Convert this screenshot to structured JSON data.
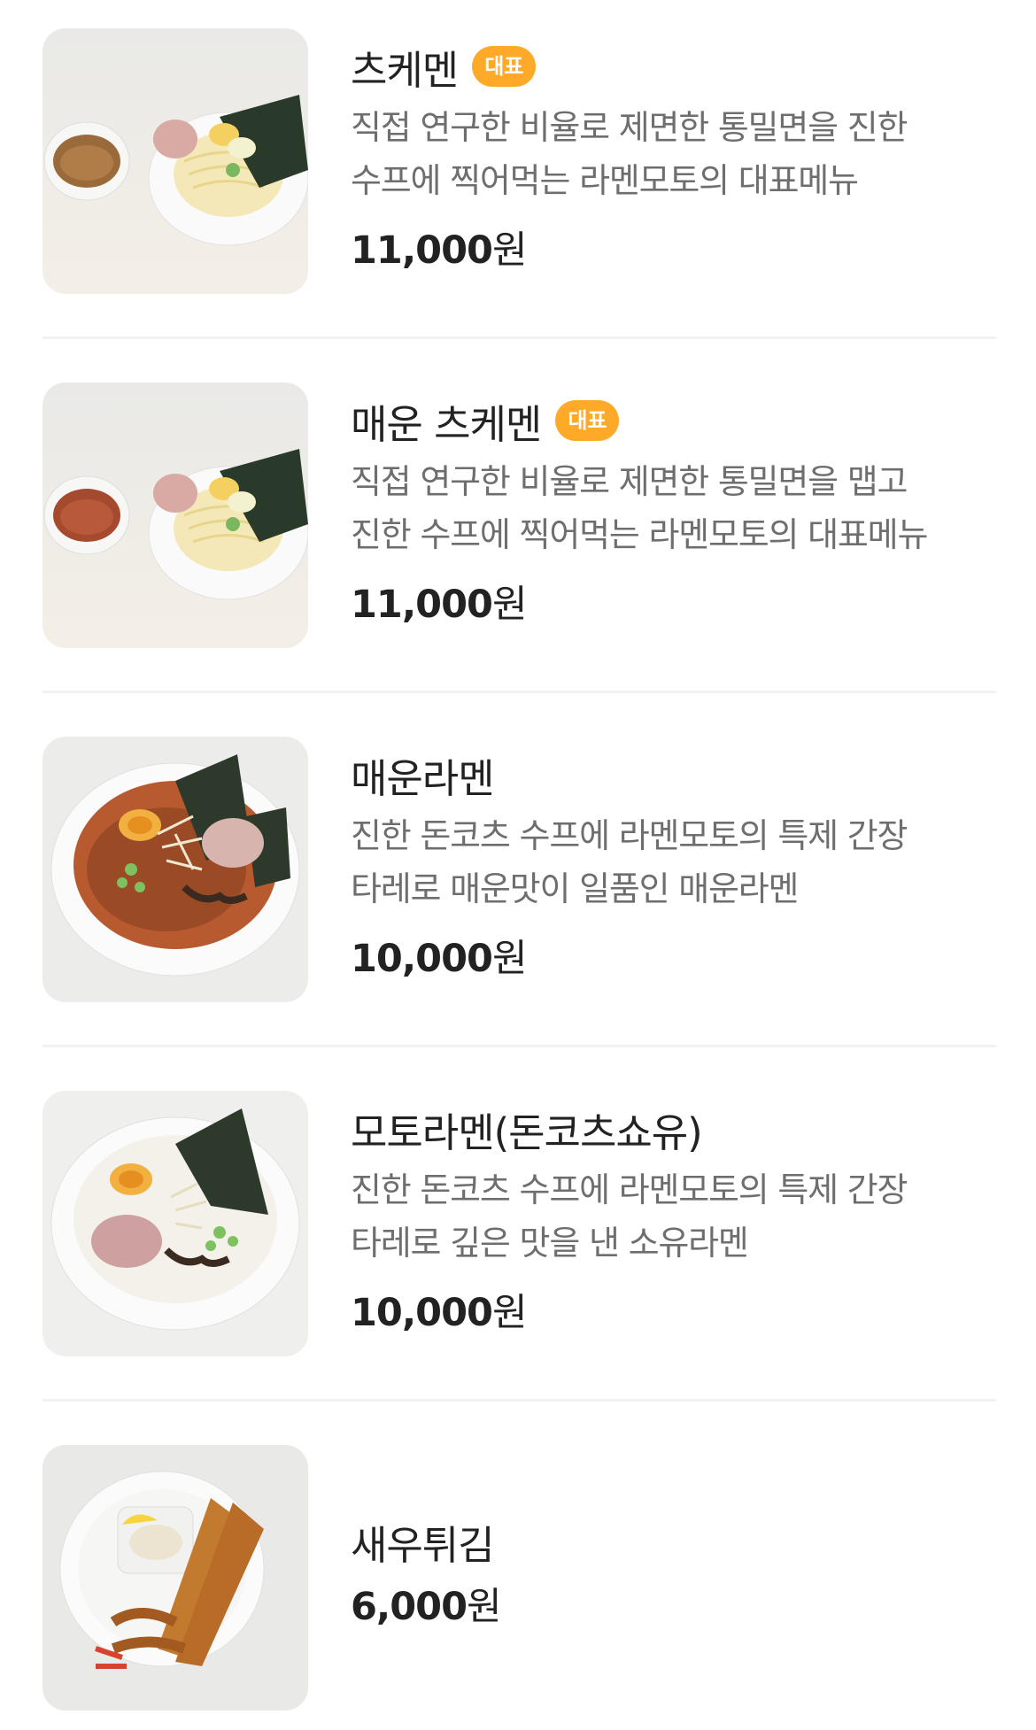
{
  "menu": {
    "items": [
      {
        "name": "츠케멘",
        "badge": "대표",
        "desc_line1": "직접 연구한 비율로 제면한 통밀면을 진한",
        "desc_line2": "수프에 찍어먹는 라멘모토의 대표메뉴",
        "price": "11,000",
        "currency": "원",
        "image": "tsukemen-photo"
      },
      {
        "name": "매운 츠케멘",
        "badge": "대표",
        "desc_line1": "직접 연구한 비율로 제면한 통밀면을 맵고",
        "desc_line2": "진한 수프에 찍어먹는 라멘모토의 대표메뉴",
        "price": "11,000",
        "currency": "원",
        "image": "spicy-tsukemen-photo"
      },
      {
        "name": "매운라멘",
        "desc_line1": "진한 돈코츠 수프에 라멘모토의 특제 간장",
        "desc_line2": "타레로 매운맛이 일품인 매운라멘",
        "price": "10,000",
        "currency": "원",
        "image": "spicy-ramen-photo"
      },
      {
        "name": "모토라멘(돈코츠쇼유)",
        "desc_line1": "진한 돈코츠 수프에 라멘모토의 특제 간장",
        "desc_line2": "타레로 깊은 맛을 낸 소유라멘",
        "price": "10,000",
        "currency": "원",
        "image": "moto-ramen-photo"
      },
      {
        "name": "새우튀김",
        "price": "6,000",
        "currency": "원",
        "image": "fried-shrimp-photo"
      }
    ]
  },
  "colors": {
    "badge": "#ffa928",
    "name": "#222222",
    "description": "#6e6e6e",
    "divider": "#f2f2f2"
  }
}
